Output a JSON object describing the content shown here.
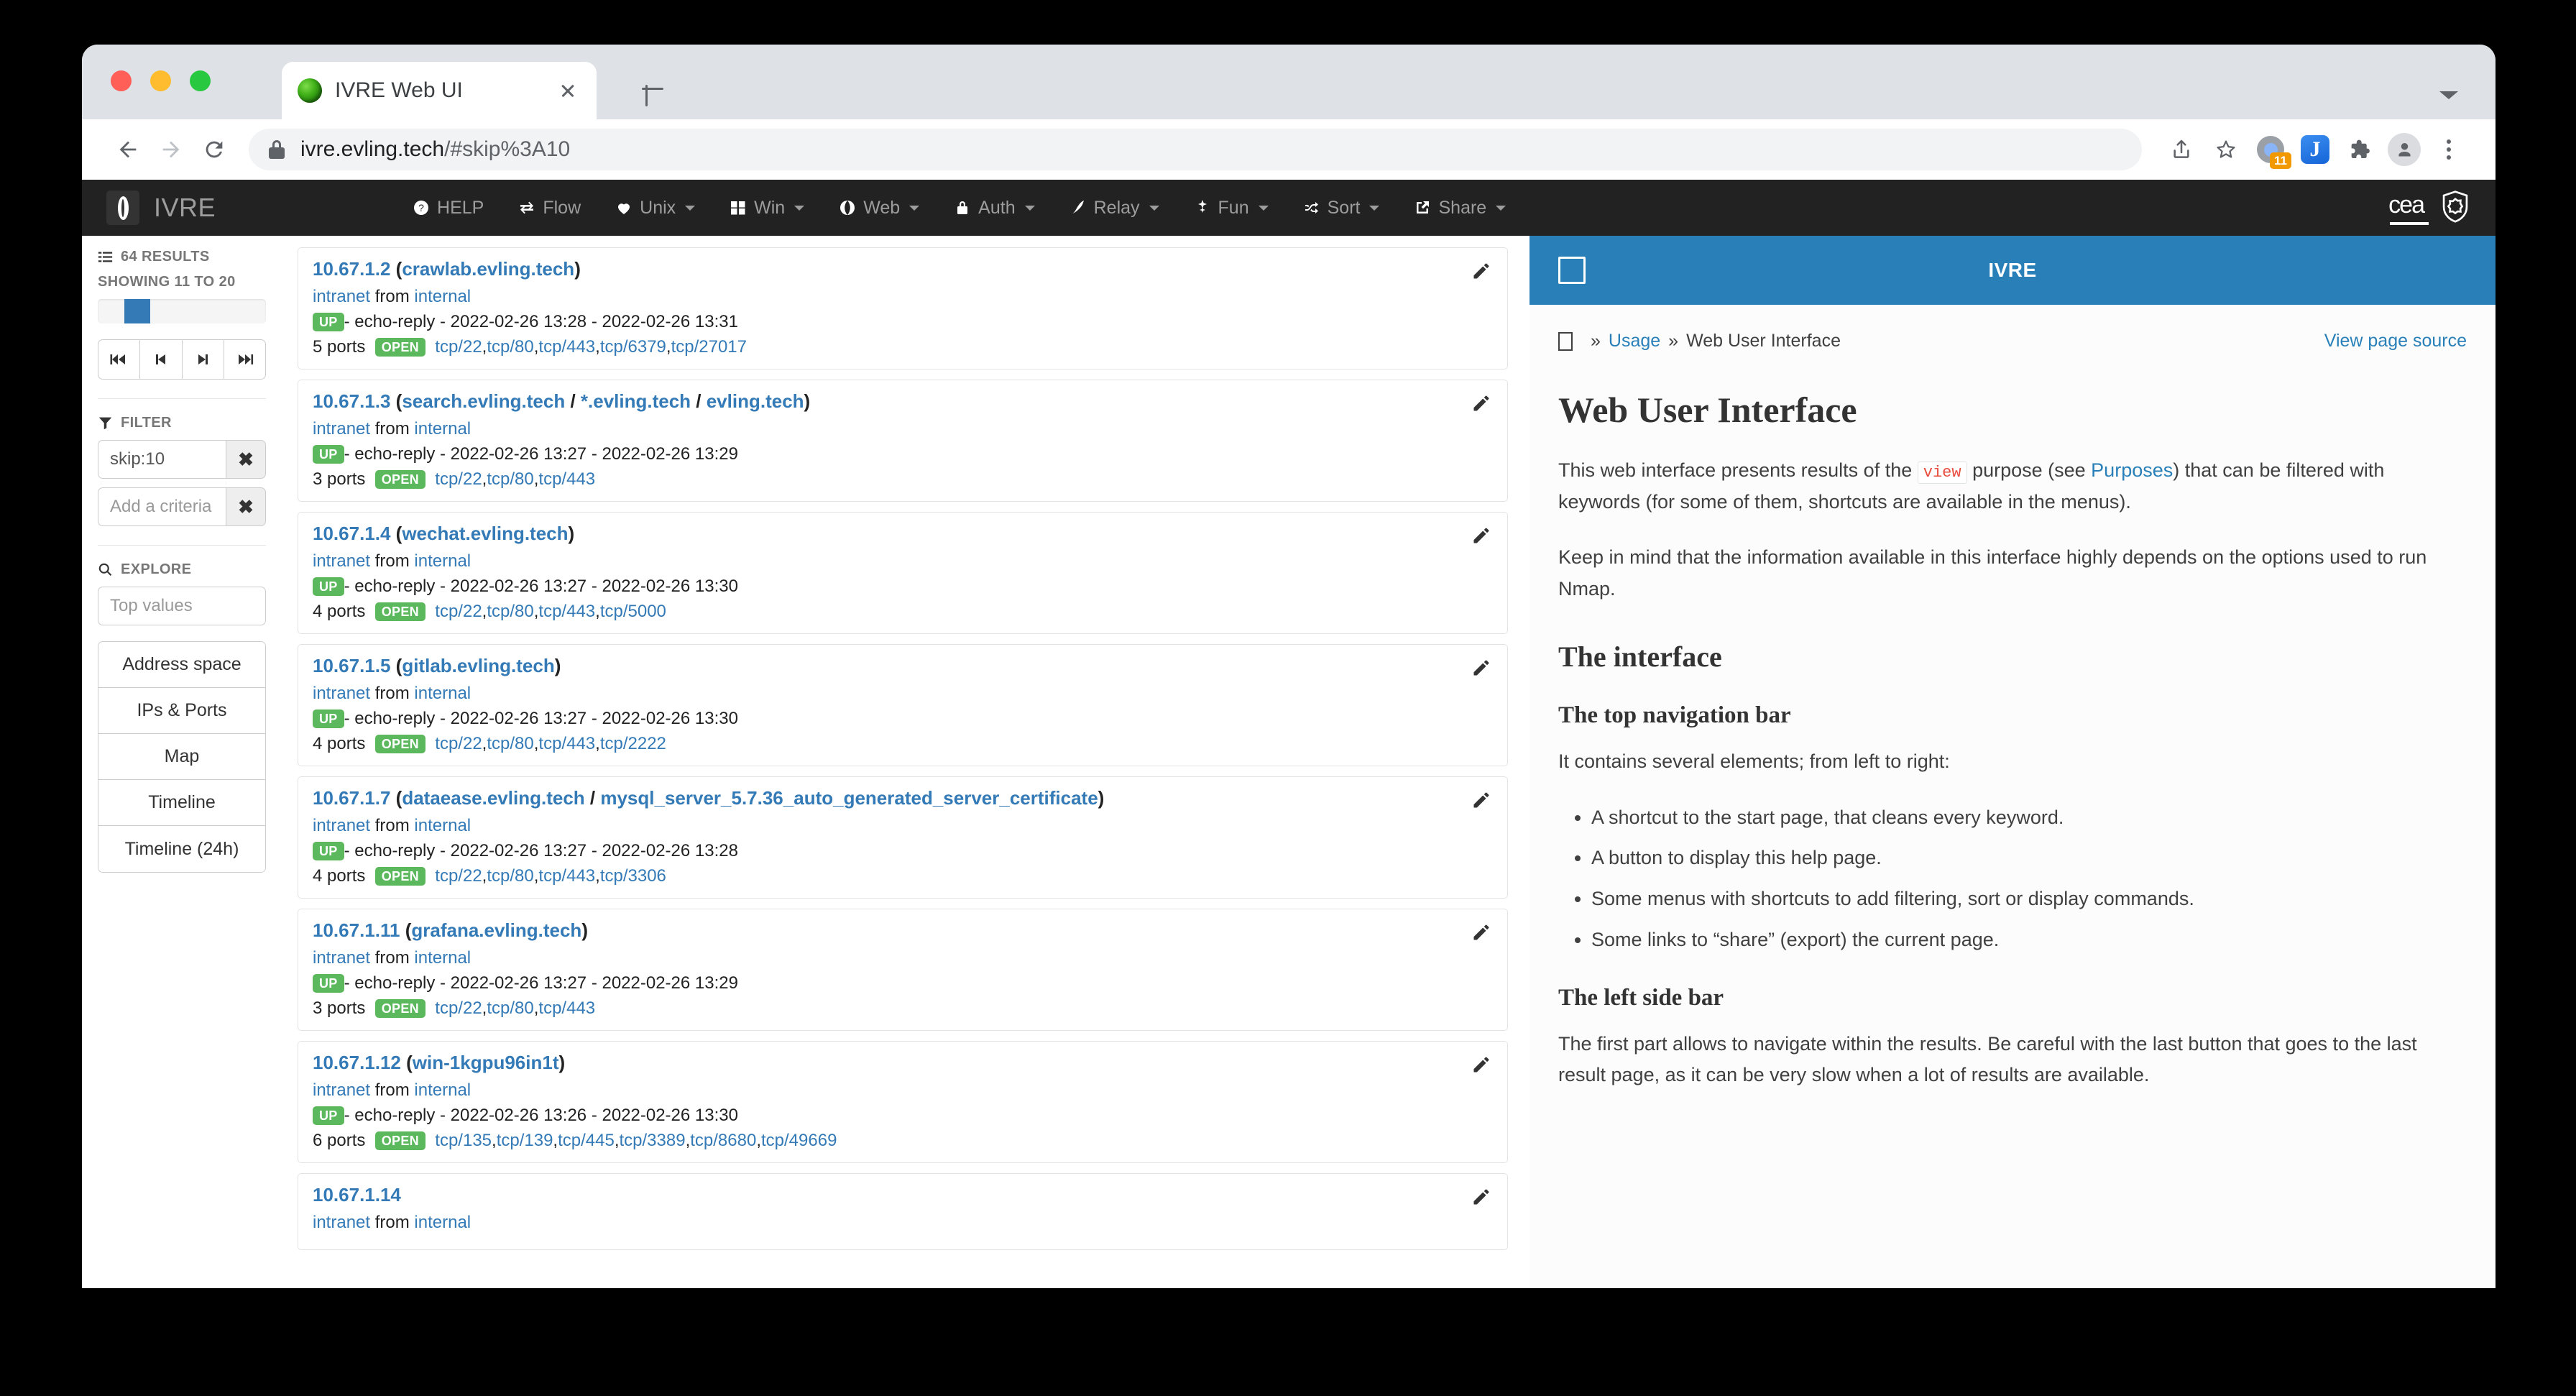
{
  "browser": {
    "tab_title": "IVRE Web UI",
    "url_main": "ivre.evling.tech",
    "url_fragment": "/#skip%3A10",
    "extension_badge_count": "11",
    "extension_letter": "J"
  },
  "navbar": {
    "brand": "IVRE",
    "items": [
      {
        "label": "HELP",
        "icon": "question-circle-icon",
        "caret": false
      },
      {
        "label": "Flow",
        "icon": "exchange-icon",
        "caret": false
      },
      {
        "label": "Unix",
        "icon": "heart-icon",
        "caret": true
      },
      {
        "label": "Win",
        "icon": "windows-icon",
        "caret": true
      },
      {
        "label": "Web",
        "icon": "globe-icon",
        "caret": true
      },
      {
        "label": "Auth",
        "icon": "lock-icon",
        "caret": true
      },
      {
        "label": "Relay",
        "icon": "rocket-icon",
        "caret": true
      },
      {
        "label": "Fun",
        "icon": "magic-icon",
        "caret": true
      },
      {
        "label": "Sort",
        "icon": "shuffle-icon",
        "caret": true
      },
      {
        "label": "Share",
        "icon": "share-icon",
        "caret": true
      }
    ],
    "right_logo": "cea",
    "right_badge": "shield-icon"
  },
  "sidebar": {
    "results_count": "64 RESULTS",
    "showing": "SHOWING 11 TO 20",
    "progress": {
      "start_pct": 15.6,
      "width_pct": 15.6,
      "fill_color": "#337ab7"
    },
    "pager_buttons": [
      {
        "name": "first-page",
        "glyph": "first"
      },
      {
        "name": "previous-page",
        "glyph": "prev"
      },
      {
        "name": "next-page",
        "glyph": "next"
      },
      {
        "name": "last-page",
        "glyph": "last"
      }
    ],
    "filter_label": "FILTER",
    "filter_value": "skip:10",
    "filter_placeholder": "Add a criteria",
    "explore_label": "EXPLORE",
    "explore_placeholder": "Top values",
    "explore_buttons": [
      "Address space",
      "IPs & Ports",
      "Map",
      "Timeline",
      "Timeline (24h)"
    ]
  },
  "results": [
    {
      "ip": "10.67.1.2",
      "hostnames": [
        "crawlab.evling.tech"
      ],
      "source": "intranet",
      "source_from": "internal",
      "status": "UP",
      "reason": "echo-reply",
      "first_seen": "2022-02-26 13:28",
      "last_seen": "2022-02-26 13:31",
      "port_count": "5 ports",
      "port_state": "OPEN",
      "ports": [
        "tcp/22",
        "tcp/80",
        "tcp/443",
        "tcp/6379",
        "tcp/27017"
      ]
    },
    {
      "ip": "10.67.1.3",
      "hostnames": [
        "search.evling.tech",
        "*.evling.tech",
        "evling.tech"
      ],
      "source": "intranet",
      "source_from": "internal",
      "status": "UP",
      "reason": "echo-reply",
      "first_seen": "2022-02-26 13:27",
      "last_seen": "2022-02-26 13:29",
      "port_count": "3 ports",
      "port_state": "OPEN",
      "ports": [
        "tcp/22",
        "tcp/80",
        "tcp/443"
      ]
    },
    {
      "ip": "10.67.1.4",
      "hostnames": [
        "wechat.evling.tech"
      ],
      "source": "intranet",
      "source_from": "internal",
      "status": "UP",
      "reason": "echo-reply",
      "first_seen": "2022-02-26 13:27",
      "last_seen": "2022-02-26 13:30",
      "port_count": "4 ports",
      "port_state": "OPEN",
      "ports": [
        "tcp/22",
        "tcp/80",
        "tcp/443",
        "tcp/5000"
      ]
    },
    {
      "ip": "10.67.1.5",
      "hostnames": [
        "gitlab.evling.tech"
      ],
      "source": "intranet",
      "source_from": "internal",
      "status": "UP",
      "reason": "echo-reply",
      "first_seen": "2022-02-26 13:27",
      "last_seen": "2022-02-26 13:30",
      "port_count": "4 ports",
      "port_state": "OPEN",
      "ports": [
        "tcp/22",
        "tcp/80",
        "tcp/443",
        "tcp/2222"
      ]
    },
    {
      "ip": "10.67.1.7",
      "hostnames": [
        "dataease.evling.tech",
        "mysql_server_5.7.36_auto_generated_server_certificate"
      ],
      "source": "intranet",
      "source_from": "internal",
      "status": "UP",
      "reason": "echo-reply",
      "first_seen": "2022-02-26 13:27",
      "last_seen": "2022-02-26 13:28",
      "port_count": "4 ports",
      "port_state": "OPEN",
      "ports": [
        "tcp/22",
        "tcp/80",
        "tcp/443",
        "tcp/3306"
      ]
    },
    {
      "ip": "10.67.1.11",
      "hostnames": [
        "grafana.evling.tech"
      ],
      "source": "intranet",
      "source_from": "internal",
      "status": "UP",
      "reason": "echo-reply",
      "first_seen": "2022-02-26 13:27",
      "last_seen": "2022-02-26 13:29",
      "port_count": "3 ports",
      "port_state": "OPEN",
      "ports": [
        "tcp/22",
        "tcp/80",
        "tcp/443"
      ]
    },
    {
      "ip": "10.67.1.12",
      "hostnames": [
        "win-1kgpu96in1t"
      ],
      "source": "intranet",
      "source_from": "internal",
      "status": "UP",
      "reason": "echo-reply",
      "first_seen": "2022-02-26 13:26",
      "last_seen": "2022-02-26 13:30",
      "port_count": "6 ports",
      "port_state": "OPEN",
      "ports": [
        "tcp/135",
        "tcp/139",
        "tcp/445",
        "tcp/3389",
        "tcp/8680",
        "tcp/49669"
      ]
    },
    {
      "ip": "10.67.1.14",
      "hostnames": [],
      "source": "intranet",
      "source_from": "internal",
      "status": "",
      "reason": "",
      "first_seen": "",
      "last_seen": "",
      "port_count": "",
      "port_state": "",
      "ports": []
    }
  ],
  "docs": {
    "header_title": "IVRE",
    "breadcrumb": {
      "usage": "Usage",
      "current": "Web User Interface",
      "separator": "»"
    },
    "view_source": "View page source",
    "h1": "Web User Interface",
    "p1_before": "This web interface presents results of the ",
    "p1_code": "view",
    "p1_mid": " purpose (see ",
    "p1_link": "Purposes",
    "p1_after": ") that can be filtered with keywords (for some of them, shortcuts are available in the menus).",
    "p2": "Keep in mind that the information available in this interface highly depends on the options used to run Nmap.",
    "h2_interface": "The interface",
    "h3_topnav": "The top navigation bar",
    "p3": "It contains several elements; from left to right:",
    "bullets": [
      "A shortcut to the start page, that cleans every keyword.",
      "A button to display this help page.",
      "Some menus with shortcuts to add filtering, sort or display commands.",
      "Some links to “share” (export) the current page."
    ],
    "h3_leftbar": "The left side bar",
    "p4": "The first part allows to navigate within the results. Be careful with the last button that goes to the last result page, as it can be very slow when a lot of results are available."
  }
}
